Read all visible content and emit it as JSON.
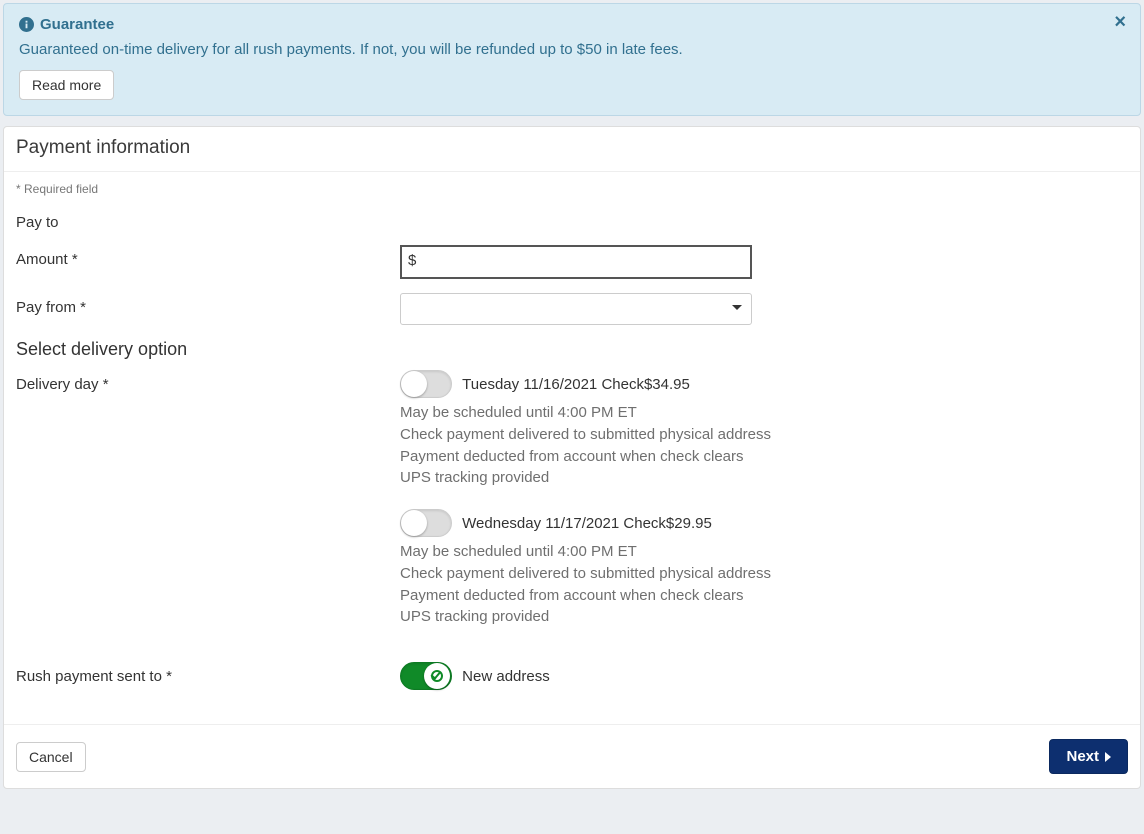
{
  "alert": {
    "title": "Guarantee",
    "text": "Guaranteed on-time delivery for all rush payments. If not, you will be refunded up to $50 in late fees.",
    "read_more": "Read more"
  },
  "heading": "Payment information",
  "required_note": "* Required field",
  "labels": {
    "pay_to": "Pay to",
    "amount": "Amount *",
    "pay_from": "Pay from *",
    "delivery_section": "Select delivery option",
    "delivery_day": "Delivery day *",
    "rush_sent_to": "Rush payment sent to *"
  },
  "amount": {
    "prefix": "$",
    "value": ""
  },
  "pay_from": {
    "value": ""
  },
  "delivery_options": [
    {
      "label": "Tuesday 11/16/2021 Check$34.95",
      "on": false,
      "details": [
        "May be scheduled until 4:00 PM ET",
        "Check payment delivered to submitted physical address",
        "Payment deducted from account when check clears",
        "UPS tracking provided"
      ]
    },
    {
      "label": "Wednesday 11/17/2021 Check$29.95",
      "on": false,
      "details": [
        "May be scheduled until 4:00 PM ET",
        "Check payment delivered to submitted physical address",
        "Payment deducted from account when check clears",
        "UPS tracking provided"
      ]
    }
  ],
  "rush_address": {
    "on": true,
    "label": "New address"
  },
  "footer": {
    "cancel": "Cancel",
    "next": "Next"
  }
}
